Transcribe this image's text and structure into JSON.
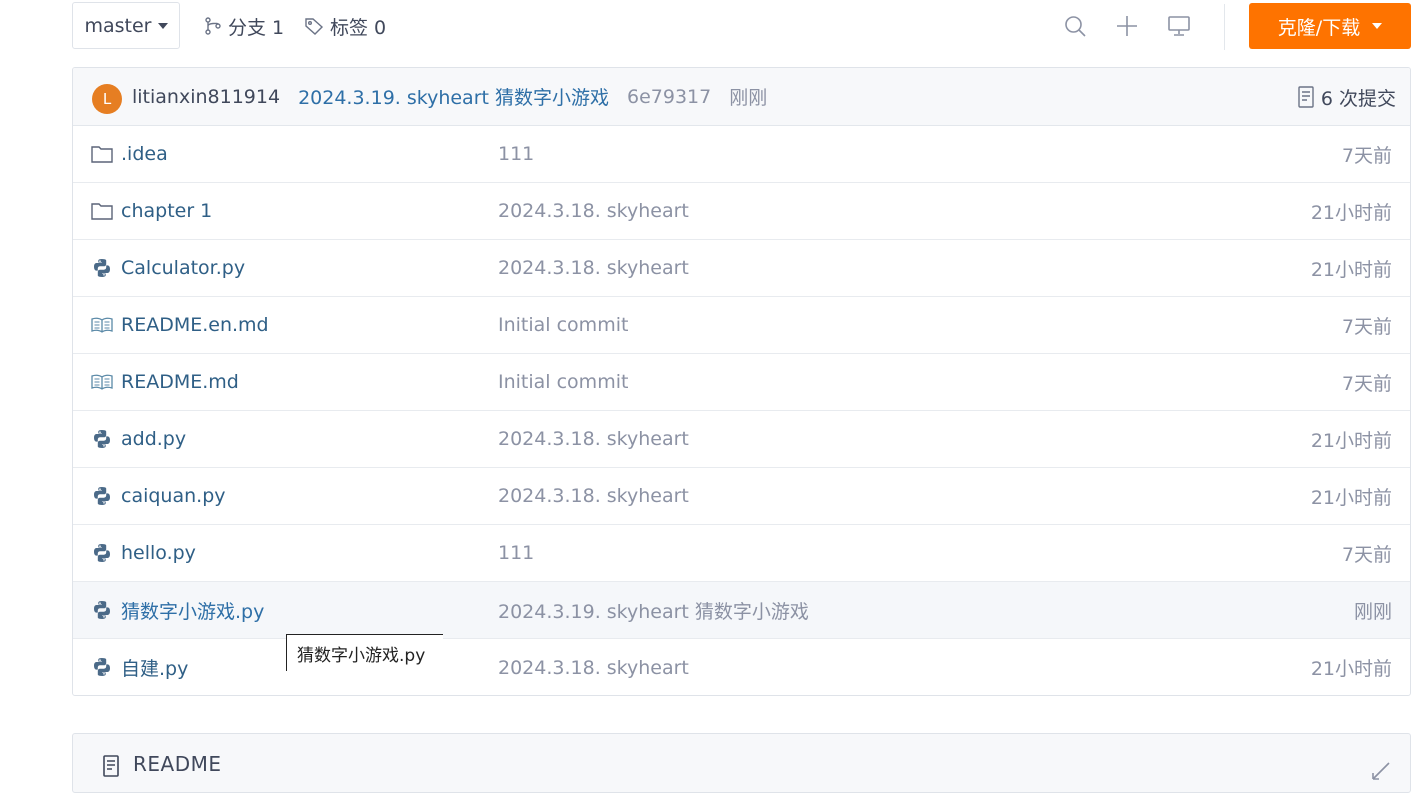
{
  "toolbar": {
    "branch": "master",
    "branches_label": "分支 1",
    "tags_label": "标签 0",
    "clone_label": "克隆/下载"
  },
  "commit": {
    "avatar_letter": "L",
    "author": "litianxin811914",
    "message": "2024.3.19. skyheart 猜数字小游戏",
    "sha": "6e79317",
    "time": "刚刚",
    "count_label": "6 次提交"
  },
  "files": [
    {
      "icon": "folder-icon",
      "name": ".idea",
      "commit": "111",
      "time": "7天前"
    },
    {
      "icon": "folder-icon",
      "name": "chapter 1",
      "commit": "2024.3.18. skyheart",
      "time": "21小时前"
    },
    {
      "icon": "python-file-icon",
      "name": "Calculator.py",
      "commit": "2024.3.18. skyheart",
      "time": "21小时前"
    },
    {
      "icon": "book-icon",
      "name": "README.en.md",
      "commit": "Initial commit",
      "time": "7天前"
    },
    {
      "icon": "book-icon",
      "name": "README.md",
      "commit": "Initial commit",
      "time": "7天前"
    },
    {
      "icon": "python-file-icon",
      "name": "add.py",
      "commit": "2024.3.18. skyheart",
      "time": "21小时前"
    },
    {
      "icon": "python-file-icon",
      "name": "caiquan.py",
      "commit": "2024.3.18. skyheart",
      "time": "21小时前"
    },
    {
      "icon": "python-file-icon",
      "name": "hello.py",
      "commit": "111",
      "time": "7天前"
    },
    {
      "icon": "python-file-icon",
      "name": "猜数字小游戏.py",
      "commit": "2024.3.19. skyheart 猜数字小游戏",
      "time": "刚刚"
    },
    {
      "icon": "python-file-icon",
      "name": "自建.py",
      "commit": "2024.3.18. skyheart",
      "time": "21小时前"
    }
  ],
  "tooltip": {
    "text": "猜数字小游戏.py"
  },
  "readme": {
    "title": "README"
  },
  "colors": {
    "accent": "#fe7300",
    "link": "#2e6fa7",
    "muted": "#8c92a4"
  }
}
